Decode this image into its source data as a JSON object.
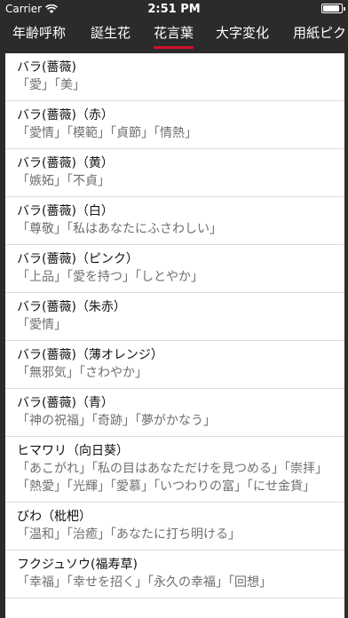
{
  "status": {
    "carrier": "Carrier",
    "time": "2:51 PM",
    "battery_level": 0.92
  },
  "tabs": [
    {
      "label": "年齢呼称",
      "selected": false
    },
    {
      "label": "誕生花",
      "selected": false
    },
    {
      "label": "花言葉",
      "selected": true
    },
    {
      "label": "大字変化",
      "selected": false
    },
    {
      "label": "用紙ピク",
      "selected": false
    }
  ],
  "accent_color": "#d0102a",
  "entries": [
    {
      "title": "バラ(薔薇)",
      "words": "「愛」「美」"
    },
    {
      "title": "バラ(薔薇)（赤）",
      "words": "「愛情」「模範」「貞節」「情熱」"
    },
    {
      "title": "バラ(薔薇)（黄）",
      "words": "「嫉妬」「不貞」"
    },
    {
      "title": "バラ(薔薇)（白）",
      "words": "「尊敬」「私はあなたにふさわしい」"
    },
    {
      "title": "バラ(薔薇)（ピンク）",
      "words": "「上品」「愛を持つ」「しとやか」"
    },
    {
      "title": "バラ(薔薇)（朱赤）",
      "words": "「愛情」"
    },
    {
      "title": "バラ(薔薇)（薄オレンジ）",
      "words": "「無邪気」「さわやか」"
    },
    {
      "title": "バラ(薔薇)（青）",
      "words": "「神の祝福」「奇跡」「夢がかなう」"
    },
    {
      "title": "ヒマワリ（向日葵）",
      "words": "「あこがれ」「私の目はあなただけを見つめる」「崇拝」「熱愛」「光輝」「愛慕」「いつわりの富」「にせ金貨」"
    },
    {
      "title": "びわ（枇杷）",
      "words": "「温和」「治癒」「あなたに打ち明ける」"
    },
    {
      "title": "フクジュソウ(福寿草)",
      "words": "「幸福」「幸せを招く」「永久の幸福」「回想」"
    }
  ]
}
